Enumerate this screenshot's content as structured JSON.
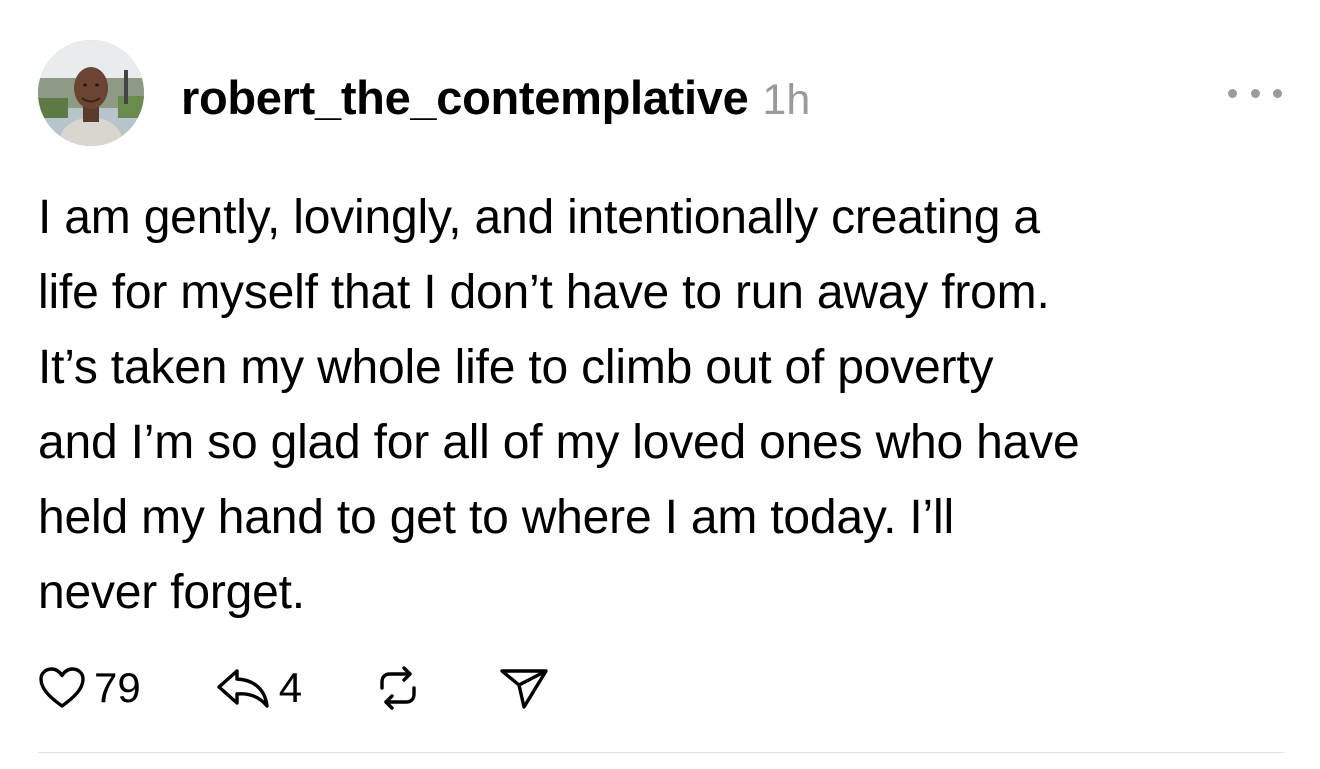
{
  "post": {
    "author": {
      "username": "robert_the_contemplative",
      "timestamp": "1h"
    },
    "more_icon": "ellipsis-icon",
    "lines": [
      "I am gently, lovingly, and intentionally creating a",
      "life for myself that I don’t have to run away from.",
      "It’s taken my whole life to climb out of poverty",
      "and I’m so glad for all of my loved ones who have",
      "held my hand to get to where I am today. I’ll",
      "never forget."
    ],
    "actions": {
      "like": {
        "icon": "heart-icon",
        "count": "79"
      },
      "reply": {
        "icon": "reply-arrow-icon",
        "count": "4"
      },
      "repost": {
        "icon": "repost-icon"
      },
      "share": {
        "icon": "send-icon"
      }
    }
  },
  "colors": {
    "text": "#000000",
    "muted": "#9a9a9a",
    "divider": "#e3e3e3"
  }
}
